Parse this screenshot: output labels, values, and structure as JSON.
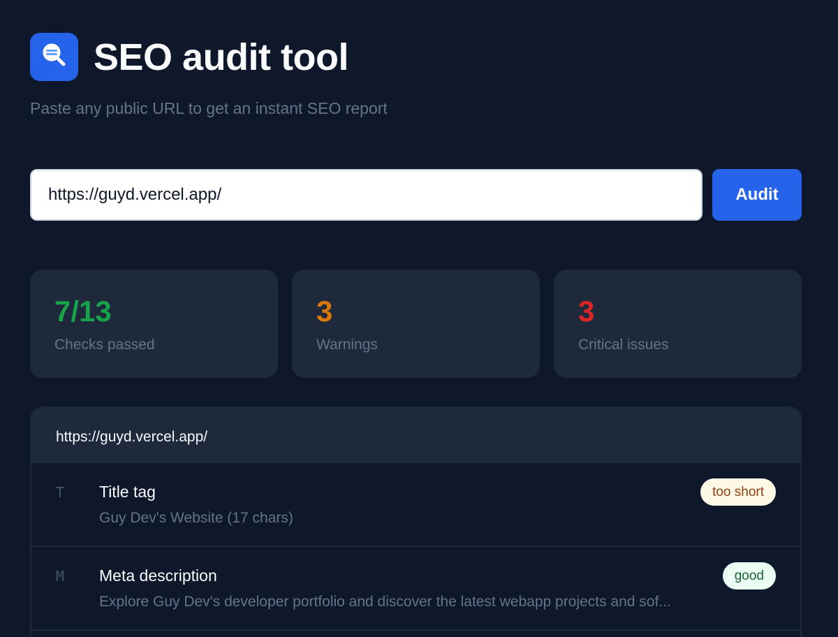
{
  "app": {
    "title": "SEO audit tool",
    "subtitle": "Paste any public URL to get an instant SEO report",
    "logo_icon": "search-icon"
  },
  "search": {
    "value": "https://guyd.vercel.app/",
    "button_label": "Audit"
  },
  "stats": [
    {
      "value": "7/13",
      "label": "Checks passed",
      "color": "#16a34a"
    },
    {
      "value": "3",
      "label": "Warnings",
      "color": "#d97706"
    },
    {
      "value": "3",
      "label": "Critical issues",
      "color": "#dc2626"
    }
  ],
  "report": {
    "url": "https://guyd.vercel.app/",
    "checks": [
      {
        "letter": "T",
        "title": "Title tag",
        "detail": "Guy Dev's Website (17 chars)",
        "badge": "too short",
        "badge_bg": "#fef9e7",
        "badge_color": "#92400e"
      },
      {
        "letter": "M",
        "title": "Meta description",
        "detail": "Explore Guy Dev's developer portfolio and discover the latest webapp projects and sof...",
        "badge": "good",
        "badge_bg": "#ecfdf5",
        "badge_color": "#166534"
      }
    ]
  }
}
